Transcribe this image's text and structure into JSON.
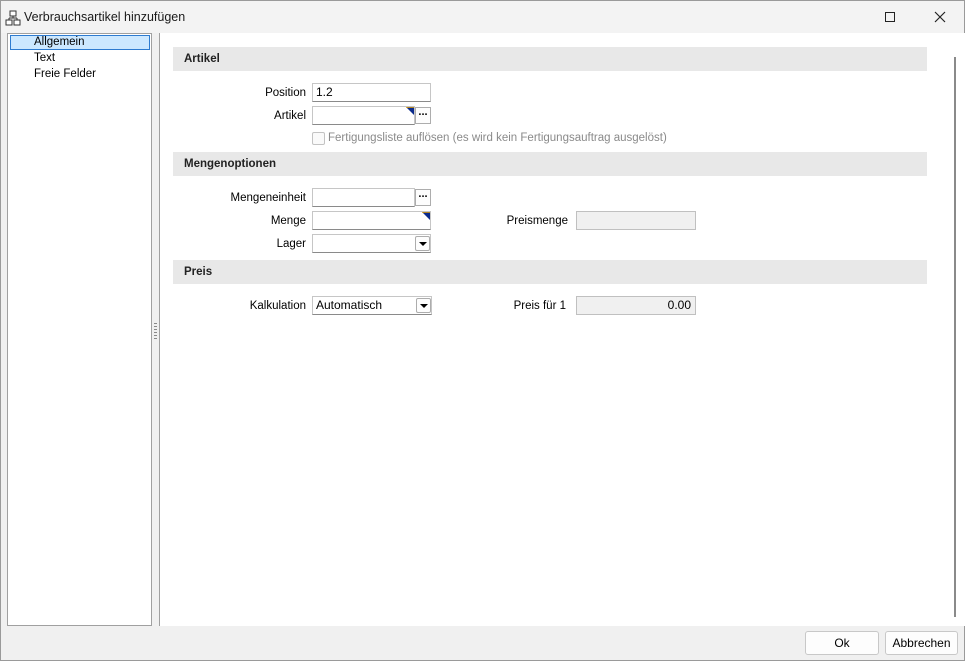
{
  "window": {
    "title": "Verbrauchsartikel hinzufügen",
    "icons": {
      "app": "tree-structure-icon",
      "maximize": "maximize-icon",
      "close": "close-icon"
    }
  },
  "nav": {
    "items": [
      {
        "label": "Allgemein",
        "selected": true
      },
      {
        "label": "Text",
        "selected": false
      },
      {
        "label": "Freie Felder",
        "selected": false
      }
    ]
  },
  "sections": {
    "artikel": {
      "title": "Artikel",
      "position_label": "Position",
      "position_value": "1.2",
      "artikel_label": "Artikel",
      "artikel_value": "",
      "fertigung_label": "Fertigungsliste auflösen (es wird kein Fertigungsauftrag ausgelöst)",
      "fertigung_checked": false
    },
    "mengenoptionen": {
      "title": "Mengenoptionen",
      "mengeneinheit_label": "Mengeneinheit",
      "mengeneinheit_value": "",
      "menge_label": "Menge",
      "menge_value": "",
      "lager_label": "Lager",
      "lager_value": "",
      "preismenge_label": "Preismenge",
      "preismenge_value": ""
    },
    "preis": {
      "title": "Preis",
      "kalkulation_label": "Kalkulation",
      "kalkulation_value": "Automatisch",
      "preis_label": "Preis für 1",
      "preis_value": "0.00"
    }
  },
  "footer": {
    "ok_label": "Ok",
    "cancel_label": "Abbrechen"
  },
  "colors": {
    "selection_bg": "#cce8ff",
    "selection_border": "#2d7bd0",
    "section_bg": "#e8e8e8",
    "corner_mark": "#0a2a8c"
  }
}
